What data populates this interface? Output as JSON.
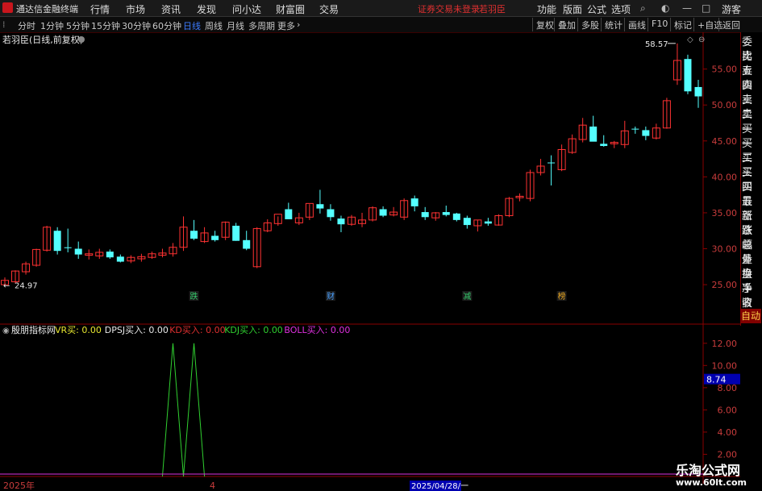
{
  "window": {
    "app_title": "通达信金融终端",
    "warning": "证券交易未登录",
    "user": "若羽臣",
    "guest": "游客"
  },
  "menu": [
    "行情",
    "市场",
    "资讯",
    "发现",
    "问小达",
    "财富圈",
    "交易"
  ],
  "right_menu": [
    "功能",
    "版面",
    "公式",
    "选项"
  ],
  "toolbar": {
    "periods": [
      "分时",
      "1分钟",
      "5分钟",
      "15分钟",
      "30分钟",
      "60分钟",
      "日线",
      "周线",
      "月线",
      "多周期",
      "更多"
    ],
    "active": "日线",
    "right_buttons": [
      "复权",
      "叠加",
      "多股",
      "统计",
      "画线",
      "F10",
      "标记",
      "+自选",
      "返回"
    ]
  },
  "main_chart": {
    "title": "若羽臣(日线,前复权)",
    "high_label": "58.57",
    "low_label": "24.97",
    "event_markers": [
      {
        "label": "跌",
        "color": "#35c96b",
        "index": 18
      },
      {
        "label": "财",
        "color": "#4aa0ff",
        "index": 31
      },
      {
        "label": "减",
        "color": "#35c96b",
        "index": 44
      },
      {
        "label": "榜",
        "color": "#e0a020",
        "index": 53
      }
    ],
    "price_ticks": [
      "55.00",
      "50.00",
      "45.00",
      "40.00",
      "35.00",
      "30.00",
      "25.00"
    ]
  },
  "indicator": {
    "name": "殷朋指标网",
    "items": [
      {
        "text": "VR买: 0.00",
        "color": "#e8e830"
      },
      {
        "text": "DPSJ买入: 0.00",
        "color": "#e8e8e8"
      },
      {
        "text": "KD买入: 0.00",
        "color": "#e03030"
      },
      {
        "text": "KDJ买入: 0.00",
        "color": "#30d030"
      },
      {
        "text": "BOLL买入: 0.00",
        "color": "#e030e0"
      }
    ],
    "ticks": [
      "12.00",
      "10.00",
      "8.00",
      "6.00",
      "4.00",
      "2.00"
    ],
    "current_value": "8.74"
  },
  "bottom_axis": {
    "year": "2025年",
    "month": "4",
    "cursor_date": "2025/04/28/一"
  },
  "side_panel": [
    "委比",
    "卖五",
    "卖四",
    "卖三",
    "卖二",
    "卖一",
    "买一",
    "买二",
    "买三",
    "买四",
    "买五",
    "最新",
    "涨跌",
    "涨幅",
    "总量",
    "外盘",
    "换手",
    "净资",
    "收益"
  ],
  "side_auto": "自动",
  "watermark": {
    "line1": "乐淘公式网",
    "line2": "www.60lt.com"
  },
  "chart_data": {
    "type": "candlestick",
    "y_range": [
      24,
      59
    ],
    "candles": [
      [
        25.0,
        26.0,
        24.97,
        25.6
      ],
      [
        25.4,
        27.0,
        25.2,
        26.9
      ],
      [
        26.8,
        28.2,
        26.4,
        27.9
      ],
      [
        27.7,
        30.0,
        27.5,
        29.9
      ],
      [
        29.8,
        33.2,
        29.6,
        33.0
      ],
      [
        32.5,
        33.0,
        29.2,
        29.7
      ],
      [
        30.2,
        32.8,
        29.5,
        30.1
      ],
      [
        30.0,
        31.0,
        28.6,
        29.2
      ],
      [
        29.1,
        29.9,
        28.5,
        29.3
      ],
      [
        29.0,
        30.0,
        28.6,
        29.5
      ],
      [
        29.6,
        29.9,
        28.6,
        28.8
      ],
      [
        28.9,
        29.2,
        28.1,
        28.2
      ],
      [
        28.3,
        29.1,
        28.0,
        28.8
      ],
      [
        28.6,
        29.3,
        28.2,
        28.9
      ],
      [
        28.8,
        29.6,
        28.6,
        29.3
      ],
      [
        29.1,
        30.0,
        28.8,
        29.4
      ],
      [
        29.3,
        30.8,
        28.9,
        30.2
      ],
      [
        30.2,
        34.5,
        29.7,
        33.0
      ],
      [
        32.5,
        34.0,
        31.2,
        31.4
      ],
      [
        31.0,
        33.0,
        30.8,
        32.2
      ],
      [
        31.8,
        32.5,
        31.0,
        31.2
      ],
      [
        31.6,
        33.8,
        31.2,
        33.7
      ],
      [
        33.2,
        33.6,
        31.1,
        31.1
      ],
      [
        31.2,
        32.5,
        29.8,
        30.0
      ],
      [
        27.5,
        33.0,
        27.3,
        32.8
      ],
      [
        32.5,
        34.1,
        32.3,
        33.6
      ],
      [
        33.5,
        34.5,
        33.2,
        34.8
      ],
      [
        35.5,
        36.4,
        34.4,
        34.1
      ],
      [
        33.6,
        35.0,
        33.3,
        34.3
      ],
      [
        34.4,
        36.2,
        34.0,
        36.3
      ],
      [
        36.2,
        38.2,
        34.9,
        35.6
      ],
      [
        35.5,
        36.2,
        33.9,
        34.4
      ],
      [
        34.2,
        34.6,
        32.3,
        33.4
      ],
      [
        33.4,
        34.7,
        33.2,
        34.4
      ],
      [
        33.5,
        35.0,
        33.0,
        34.0
      ],
      [
        34.0,
        35.9,
        33.8,
        35.7
      ],
      [
        35.5,
        35.9,
        34.4,
        34.6
      ],
      [
        34.7,
        35.8,
        34.5,
        35.1
      ],
      [
        34.4,
        37.0,
        34.0,
        36.7
      ],
      [
        37.0,
        37.4,
        35.2,
        35.9
      ],
      [
        35.1,
        35.8,
        34.0,
        34.4
      ],
      [
        34.3,
        35.1,
        33.9,
        35.0
      ],
      [
        35.1,
        36.0,
        34.5,
        34.7
      ],
      [
        34.9,
        35.0,
        33.8,
        34.0
      ],
      [
        34.3,
        34.6,
        32.8,
        33.3
      ],
      [
        33.2,
        34.0,
        32.4,
        34.0
      ],
      [
        33.8,
        34.3,
        33.2,
        33.5
      ],
      [
        33.3,
        34.8,
        33.2,
        34.6
      ],
      [
        34.6,
        37.2,
        34.4,
        37.0
      ],
      [
        37.1,
        37.7,
        36.6,
        37.3
      ],
      [
        37.0,
        41.0,
        36.6,
        40.6
      ],
      [
        40.6,
        42.5,
        40.2,
        41.5
      ],
      [
        42.0,
        43.0,
        38.8,
        41.9
      ],
      [
        41.0,
        44.5,
        40.8,
        43.8
      ],
      [
        43.4,
        45.9,
        43.2,
        45.3
      ],
      [
        45.2,
        48.2,
        44.8,
        47.2
      ],
      [
        47.0,
        48.5,
        45.4,
        44.9
      ],
      [
        44.6,
        45.8,
        44.2,
        44.3
      ],
      [
        44.6,
        45.0,
        44.0,
        44.8
      ],
      [
        44.5,
        47.8,
        44.0,
        46.4
      ],
      [
        46.7,
        47.0,
        46.0,
        46.6
      ],
      [
        46.5,
        47.0,
        45.1,
        45.7
      ],
      [
        45.4,
        47.4,
        45.2,
        46.8
      ],
      [
        46.8,
        51.0,
        46.7,
        50.6
      ],
      [
        53.5,
        58.57,
        52.8,
        56.2
      ],
      [
        56.4,
        57.0,
        51.5,
        51.9
      ],
      [
        52.5,
        53.5,
        49.6,
        51.2
      ]
    ],
    "indicator_lines": {
      "kdj_spikes": [
        {
          "index": 16,
          "value": 12
        },
        {
          "index": 18,
          "value": 12
        }
      ]
    },
    "indicator_range": [
      0,
      13
    ]
  }
}
